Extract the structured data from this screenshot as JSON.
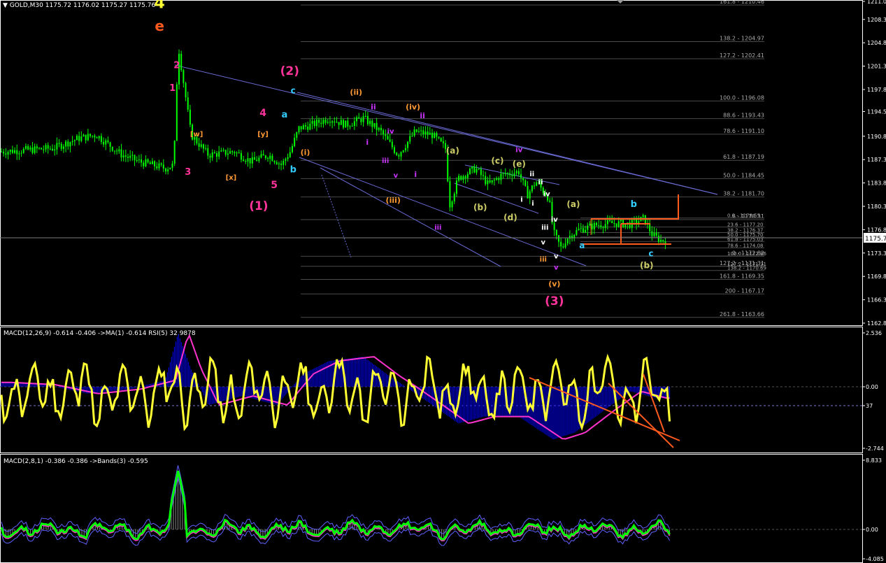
{
  "header": {
    "symbol": "GOLD,M30",
    "ohlc": "1175.72 1176.02 1175.27 1175.76",
    "macd1_label": "MACD(12,26,9) -0.614 -0.406  ->MA(1) -0.614  RSI(5) 32.9878",
    "macd2_label": "MACD(2,8,1) -0.386 -0.386  ->Bands(3) -0.595"
  },
  "colors": {
    "background": "#000000",
    "frame": "#ffffff",
    "candle": "#00ff00",
    "fib_line": "#4a4a4a",
    "trendline": "#6b6bd6",
    "orange": "#ff5a1e",
    "yellow": "#ffff33",
    "magenta": "#ff33cc",
    "histogram": "#0000ff",
    "cyan": "#33ccff",
    "olive": "#cccc66",
    "pink": "#ff3399",
    "violet": "#cc33ff",
    "goldish": "#ff9933"
  },
  "chart_data": [
    {
      "type": "candlestick",
      "title": "GOLD,M30",
      "ylim": [
        1162.8,
        1211.0
      ],
      "price_axis_ticks": [
        "1211.0",
        "1208.3",
        "1204.8",
        "1201.3",
        "1197.8",
        "1194.5",
        "1190.8",
        "1187.3",
        "1183.8",
        "1180.3",
        "1176.8",
        "1173.3",
        "1169.8",
        "1166.3",
        "1162.8"
      ],
      "current_price": "1175.7",
      "fib_levels": [
        {
          "label": "161.8 - 1210.46",
          "value": 1210.46
        },
        {
          "label": "138.2 - 1204.97",
          "value": 1204.97
        },
        {
          "label": "127.2 - 1202.41",
          "value": 1202.41
        },
        {
          "label": "100.0 - 1196.08",
          "value": 1196.08
        },
        {
          "label": "88.6 - 1193.43",
          "value": 1193.43
        },
        {
          "label": "78.6 - 1191.10",
          "value": 1191.1
        },
        {
          "label": "61.8 - 1187.19",
          "value": 1187.19
        },
        {
          "label": "50.0 - 1184.45",
          "value": 1184.45
        },
        {
          "label": "38.2 - 1181.70",
          "value": 1181.7
        },
        {
          "label": ".6 - 1178.31",
          "value": 1178.31
        },
        {
          "label": ".0 - 1172.82",
          "value": 1172.82
        },
        {
          "label": "127.2 - 1171.31",
          "value": 1171.31
        },
        {
          "label": "161.8 - 1169.35",
          "value": 1169.35
        },
        {
          "label": "200 - 1167.17",
          "value": 1167.17
        },
        {
          "label": "261.8 - 1163.66",
          "value": 1163.66
        }
      ],
      "fib_small_levels": [
        {
          "label": "0.0 - 1178.55",
          "value": 1178.55
        },
        {
          "label": "23.6 - 1177.20",
          "value": 1177.2
        },
        {
          "label": "38.2 - 1176.37",
          "value": 1176.37
        },
        {
          "label": "50.0 - 1175.70",
          "value": 1175.7
        },
        {
          "label": "61.8 - 1175.03",
          "value": 1175.03
        },
        {
          "label": "78.6 - 1174.08",
          "value": 1174.08
        },
        {
          "label": "100.0 - 1172.86",
          "value": 1172.86
        },
        {
          "label": "127.2 - 1171.31",
          "value": 1171.31
        },
        {
          "label": "138.2 - 1170.69",
          "value": 1170.69
        }
      ],
      "wave_labels": [
        {
          "text": "4",
          "color": "#ffff33",
          "size": 22,
          "bar": 0.185,
          "price": 1210.0
        },
        {
          "text": "e",
          "color": "#ff5a1e",
          "size": 20,
          "bar": 0.185,
          "price": 1206.6
        },
        {
          "text": "2",
          "color": "#ff3399",
          "size": 13,
          "bar": 0.205,
          "price": 1201.0
        },
        {
          "text": "1",
          "color": "#ff3399",
          "size": 13,
          "bar": 0.2,
          "price": 1197.6
        },
        {
          "text": "[w]",
          "color": "#ff9933",
          "size": 10,
          "bar": 0.228,
          "price": 1190.8
        },
        {
          "text": "3",
          "color": "#ff3399",
          "size": 13,
          "bar": 0.218,
          "price": 1185.0
        },
        {
          "text": "4",
          "color": "#ff3399",
          "size": 14,
          "bar": 0.305,
          "price": 1193.8
        },
        {
          "text": "[y]",
          "color": "#ff9933",
          "size": 10,
          "bar": 0.305,
          "price": 1190.8
        },
        {
          "text": "a",
          "color": "#33ccff",
          "size": 13,
          "bar": 0.33,
          "price": 1193.6
        },
        {
          "text": "[x]",
          "color": "#ff9933",
          "size": 10,
          "bar": 0.268,
          "price": 1184.3
        },
        {
          "text": "5",
          "color": "#ff3399",
          "size": 14,
          "bar": 0.318,
          "price": 1183.0
        },
        {
          "text": "b",
          "color": "#33ccff",
          "size": 13,
          "bar": 0.34,
          "price": 1185.4
        },
        {
          "text": "(1)",
          "color": "#ff3399",
          "size": 17,
          "bar": 0.3,
          "price": 1179.8
        },
        {
          "text": "(2)",
          "color": "#ff3399",
          "size": 17,
          "bar": 0.336,
          "price": 1200.0
        },
        {
          "text": "c",
          "color": "#33ccff",
          "size": 12,
          "bar": 0.34,
          "price": 1197.2
        },
        {
          "text": "(i)",
          "color": "#ff9933",
          "size": 11,
          "bar": 0.354,
          "price": 1188.0
        },
        {
          "text": "(ii)",
          "color": "#ff9933",
          "size": 11,
          "bar": 0.413,
          "price": 1197.0
        },
        {
          "text": "ii",
          "color": "#cc33ff",
          "size": 11,
          "bar": 0.433,
          "price": 1194.8
        },
        {
          "text": "i",
          "color": "#cc33ff",
          "size": 11,
          "bar": 0.426,
          "price": 1189.5
        },
        {
          "text": "iv",
          "color": "#cc33ff",
          "size": 10,
          "bar": 0.453,
          "price": 1191.2
        },
        {
          "text": "(iv)",
          "color": "#ff9933",
          "size": 11,
          "bar": 0.479,
          "price": 1194.8
        },
        {
          "text": "ii",
          "color": "#cc33ff",
          "size": 11,
          "bar": 0.49,
          "price": 1193.5
        },
        {
          "text": "iii",
          "color": "#cc33ff",
          "size": 10,
          "bar": 0.447,
          "price": 1186.8
        },
        {
          "text": "v",
          "color": "#cc33ff",
          "size": 10,
          "bar": 0.459,
          "price": 1184.6
        },
        {
          "text": "i",
          "color": "#cc33ff",
          "size": 11,
          "bar": 0.482,
          "price": 1184.7
        },
        {
          "text": "(iii)",
          "color": "#ff9933",
          "size": 11,
          "bar": 0.456,
          "price": 1180.8
        },
        {
          "text": "iii",
          "color": "#cc33ff",
          "size": 10,
          "bar": 0.508,
          "price": 1176.8
        },
        {
          "text": "(a)",
          "color": "#cccc66",
          "size": 12,
          "bar": 0.525,
          "price": 1188.2
        },
        {
          "text": "(c)",
          "color": "#cccc66",
          "size": 12,
          "bar": 0.577,
          "price": 1186.7
        },
        {
          "text": "(e)",
          "color": "#cccc66",
          "size": 12,
          "bar": 0.602,
          "price": 1186.2
        },
        {
          "text": "iv",
          "color": "#cc33ff",
          "size": 10,
          "bar": 0.602,
          "price": 1188.4
        },
        {
          "text": "(b)",
          "color": "#cccc66",
          "size": 12,
          "bar": 0.557,
          "price": 1179.7
        },
        {
          "text": "(d)",
          "color": "#cccc66",
          "size": 12,
          "bar": 0.592,
          "price": 1178.2
        },
        {
          "text": "ii",
          "color": "#ffffff",
          "size": 10,
          "bar": 0.617,
          "price": 1184.8
        },
        {
          "text": "ii",
          "color": "#ffffff",
          "size": 10,
          "bar": 0.627,
          "price": 1183.6
        },
        {
          "text": "i",
          "color": "#ffffff",
          "size": 10,
          "bar": 0.605,
          "price": 1181.0
        },
        {
          "text": "i",
          "color": "#ffffff",
          "size": 10,
          "bar": 0.618,
          "price": 1180.4
        },
        {
          "text": "iv",
          "color": "#ffffff",
          "size": 10,
          "bar": 0.634,
          "price": 1181.8
        },
        {
          "text": "iv",
          "color": "#ffffff",
          "size": 10,
          "bar": 0.643,
          "price": 1178.0
        },
        {
          "text": "iii",
          "color": "#ffffff",
          "size": 10,
          "bar": 0.632,
          "price": 1176.8
        },
        {
          "text": "v",
          "color": "#ffffff",
          "size": 10,
          "bar": 0.63,
          "price": 1174.6
        },
        {
          "text": "v",
          "color": "#ffffff",
          "size": 10,
          "bar": 0.645,
          "price": 1172.5
        },
        {
          "text": "iii",
          "color": "#ff9933",
          "size": 10,
          "bar": 0.63,
          "price": 1172.0
        },
        {
          "text": "v",
          "color": "#cc33ff",
          "size": 10,
          "bar": 0.645,
          "price": 1170.8
        },
        {
          "text": "(v)",
          "color": "#ff9933",
          "size": 11,
          "bar": 0.643,
          "price": 1168.3
        },
        {
          "text": "(3)",
          "color": "#ff3399",
          "size": 17,
          "bar": 0.643,
          "price": 1165.5
        },
        {
          "text": "(a)",
          "color": "#cccc66",
          "size": 12,
          "bar": 0.665,
          "price": 1180.2
        },
        {
          "text": "a",
          "color": "#33ccff",
          "size": 12,
          "bar": 0.675,
          "price": 1174.0
        },
        {
          "text": "b",
          "color": "#33ccff",
          "size": 13,
          "bar": 0.735,
          "price": 1180.2
        },
        {
          "text": "c",
          "color": "#33ccff",
          "size": 12,
          "bar": 0.755,
          "price": 1172.8
        },
        {
          "text": "(b)",
          "color": "#cccc66",
          "size": 12,
          "bar": 0.75,
          "price": 1171.0
        }
      ]
    },
    {
      "type": "line",
      "title": "MACD(12,26,9) -0.614 -0.406  ->MA(1) -0.614  RSI(5) 32.9878",
      "ylim": [
        -2.744,
        2.536
      ],
      "axis_ticks": [
        "2.536",
        "0.00",
        "37",
        "-2.744"
      ],
      "series": [
        {
          "name": "MACD histogram"
        },
        {
          "name": "RSI(5)"
        }
      ]
    },
    {
      "type": "line",
      "title": "MACD(2,8,1) -0.386 -0.386  ->Bands(3) -0.595",
      "ylim": [
        -4.085,
        8.833
      ],
      "axis_ticks": [
        "8.833",
        "0.00",
        "-4.085"
      ]
    }
  ]
}
